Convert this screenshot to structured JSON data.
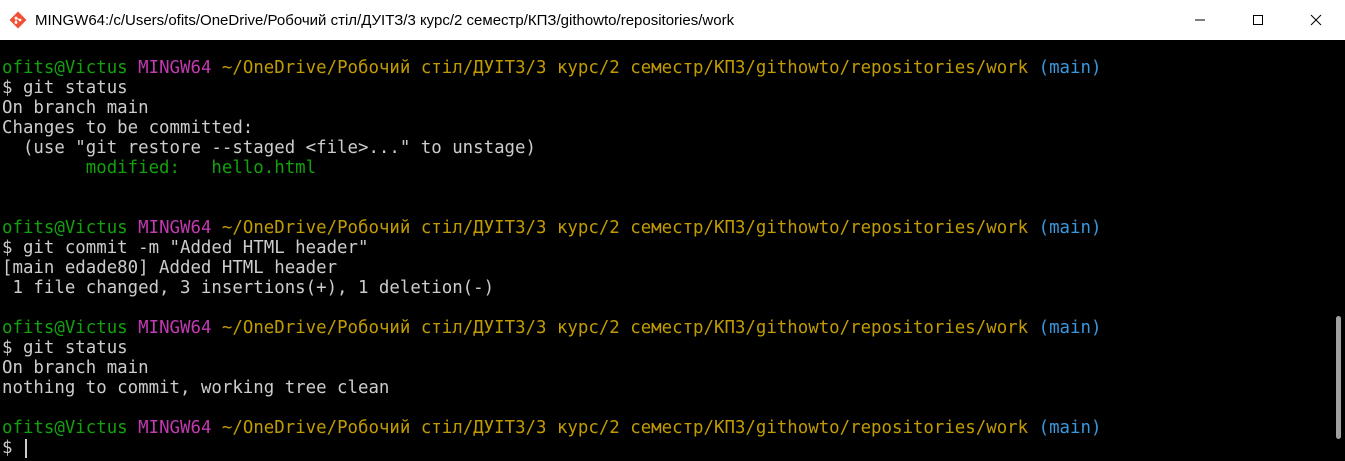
{
  "window": {
    "title": "MINGW64:/c/Users/ofits/OneDrive/Робочий стіл/ДУІТЗ/3 курс/2 семестр/КПЗ/githowto/repositories/work",
    "icon": "git-bash-icon",
    "controls": {
      "minimize": "minimize-icon",
      "maximize": "maximize-icon",
      "close": "close-icon"
    }
  },
  "prompt": {
    "user": "ofits@Victus",
    "system": "MINGW64",
    "path": "~/OneDrive/Робочий стіл/ДУІТЗ/3 курс/2 семестр/КПЗ/githowto/repositories/work",
    "branch": "(main)"
  },
  "blocks": [
    {
      "command": "$ git status",
      "output": [
        "On branch main",
        "Changes to be committed:",
        "  (use \"git restore --staged <file>...\" to unstage)"
      ],
      "modified_label": "        modified:   hello.html"
    },
    {
      "command": "$ git commit -m \"Added HTML header\"",
      "output": [
        "[main edade80] Added HTML header",
        " 1 file changed, 3 insertions(+), 1 deletion(-)"
      ]
    },
    {
      "command": "$ git status",
      "output": [
        "On branch main",
        "nothing to commit, working tree clean"
      ]
    },
    {
      "command": "$ "
    }
  ],
  "colors": {
    "user": "#13a10e",
    "system": "#c239b3",
    "path": "#c19c00",
    "branch": "#3a96dd",
    "text": "#cccccc",
    "background": "#000000"
  }
}
